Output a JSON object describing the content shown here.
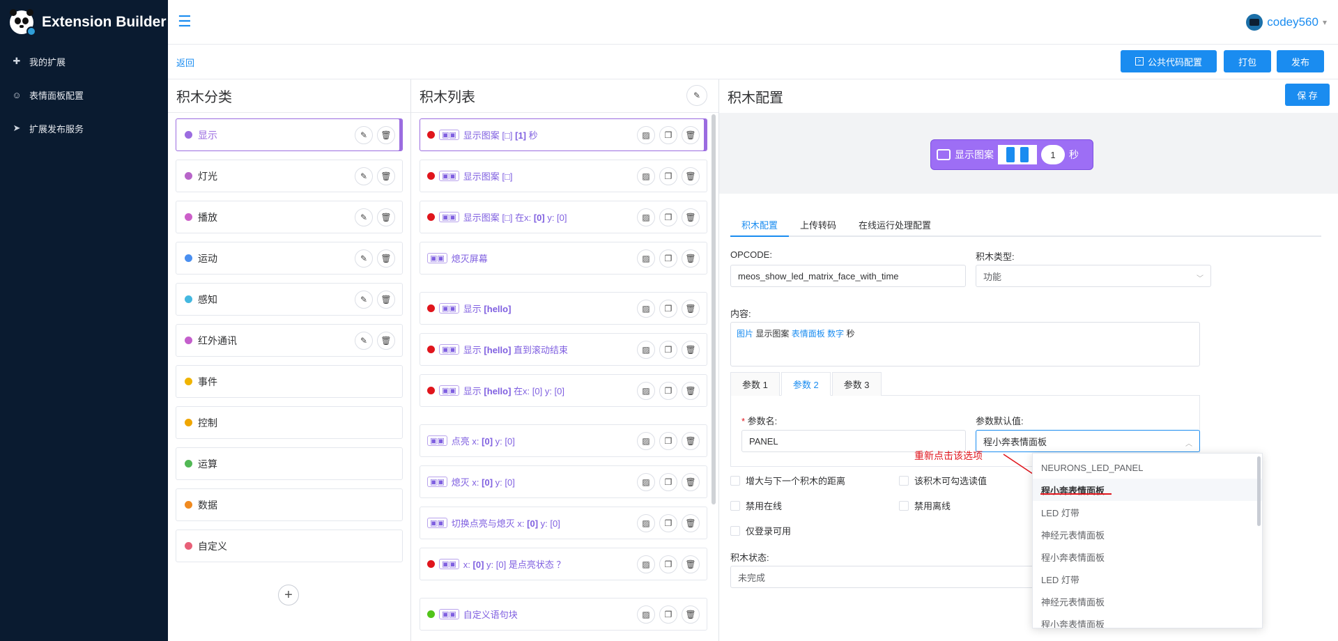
{
  "app": {
    "title": "Extension Builder"
  },
  "sidebar": {
    "items": [
      {
        "label": "我的扩展",
        "icon": "puzzle-icon"
      },
      {
        "label": "表情面板配置",
        "icon": "smile-icon"
      },
      {
        "label": "扩展发布服务",
        "icon": "send-icon"
      }
    ]
  },
  "header": {
    "user": "codey560",
    "user_caret": "▾"
  },
  "subbar": {
    "back": "返回",
    "public_code_btn": "公共代码配置",
    "pack_btn": "打包",
    "publish_btn": "发布"
  },
  "categories": {
    "title": "积木分类",
    "items": [
      {
        "label": "显示",
        "color": "#9b6ce0",
        "editable": true
      },
      {
        "label": "灯光",
        "color": "#b865c9",
        "editable": true
      },
      {
        "label": "播放",
        "color": "#cc5fc9",
        "editable": true
      },
      {
        "label": "运动",
        "color": "#4a8ff0",
        "editable": true
      },
      {
        "label": "感知",
        "color": "#44b8e0",
        "editable": true
      },
      {
        "label": "红外通讯",
        "color": "#c45fcc",
        "editable": true
      },
      {
        "label": "事件",
        "color": "#f0b400",
        "editable": false
      },
      {
        "label": "控制",
        "color": "#f0a600",
        "editable": false
      },
      {
        "label": "运算",
        "color": "#52b855",
        "editable": false
      },
      {
        "label": "数据",
        "color": "#f08a20",
        "editable": false
      },
      {
        "label": "自定义",
        "color": "#e86078",
        "editable": false
      }
    ]
  },
  "blocks": {
    "title": "积木列表",
    "items": [
      {
        "prefix": "显示图案 [□] ",
        "bold": "[1]",
        "suffix": " 秒",
        "dot": "red",
        "active": true
      },
      {
        "prefix": "显示图案 [□]",
        "bold": "",
        "suffix": "",
        "dot": "red"
      },
      {
        "prefix": "显示图案 [□] 在x: ",
        "bold": "[0]",
        "suffix": " y: [0]",
        "dot": "red"
      },
      {
        "prefix": "熄灭屏幕",
        "bold": "",
        "suffix": "",
        "dot": "none"
      },
      {
        "prefix": "显示 ",
        "bold": "[hello]",
        "suffix": "",
        "dot": "red",
        "gap": true
      },
      {
        "prefix": "显示 ",
        "bold": "[hello]",
        "suffix": " 直到滚动结束",
        "dot": "red"
      },
      {
        "prefix": "显示 ",
        "bold": "[hello]",
        "suffix": " 在x: [0] y: [0]",
        "dot": "red"
      },
      {
        "prefix": "点亮 x: ",
        "bold": "[0]",
        "suffix": " y: [0]",
        "dot": "none",
        "gap": true
      },
      {
        "prefix": "熄灭 x: ",
        "bold": "[0]",
        "suffix": " y: [0]",
        "dot": "none"
      },
      {
        "prefix": "切换点亮与熄灭 x: ",
        "bold": "[0]",
        "suffix": " y: [0]",
        "dot": "none"
      },
      {
        "prefix": "x: ",
        "bold": "[0]",
        "suffix": " y: [0] 是点亮状态 ？",
        "dot": "red"
      },
      {
        "prefix": "自定义语句块",
        "bold": "",
        "suffix": "",
        "dot": "green",
        "gap": true
      }
    ]
  },
  "config": {
    "title": "积木配置",
    "save_btn": "保 存",
    "preview": {
      "label": "显示图案",
      "number": "1",
      "unit": "秒"
    },
    "tabs": [
      "积木配置",
      "上传转码",
      "在线运行处理配置"
    ],
    "opcode_label": "OPCODE:",
    "opcode_value": "meos_show_led_matrix_face_with_time",
    "type_label": "积木类型:",
    "type_value": "功能",
    "content_label": "内容:",
    "content_tokens": [
      "图片",
      "显示图案",
      "表情面板",
      "数字",
      "秒"
    ],
    "param_tabs": [
      "参数 1",
      "参数 2",
      "参数 3"
    ],
    "param_name_label": "参数名:",
    "param_name_value": "PANEL",
    "param_default_label": "参数默认值:",
    "param_default_value": "程小奔表情面板",
    "checkboxes": [
      "增大与下一个积木的距离",
      "该积木可勾选读值",
      "禁用在线",
      "禁用离线",
      "仅登录可用"
    ],
    "status_label": "积木状态:",
    "status_value": "未完成"
  },
  "dropdown": {
    "options": [
      "NEURONS_LED_PANEL",
      "程小奔表情面板",
      "LED 灯带",
      "神经元表情面板",
      "程小奔表情面板",
      "LED 灯带",
      "神经元表情面板",
      "程小奔表情面板"
    ],
    "hover_index": 1
  },
  "annotation": "重新点击该选项"
}
